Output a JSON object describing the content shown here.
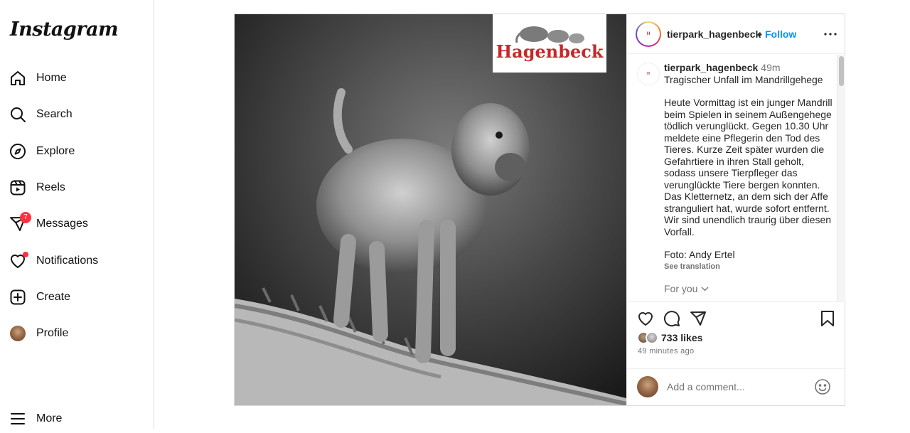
{
  "app": {
    "logo": "Instagram"
  },
  "sidebar": {
    "items": [
      {
        "label": "Home",
        "icon": "home-icon"
      },
      {
        "label": "Search",
        "icon": "search-icon"
      },
      {
        "label": "Explore",
        "icon": "compass-icon"
      },
      {
        "label": "Reels",
        "icon": "reels-icon"
      },
      {
        "label": "Messages",
        "icon": "messenger-icon",
        "badge": "7"
      },
      {
        "label": "Notifications",
        "icon": "heart-icon",
        "has_dot": true
      },
      {
        "label": "Create",
        "icon": "plus-square-icon"
      },
      {
        "label": "Profile",
        "icon": "avatar"
      },
      {
        "label": "More",
        "icon": "menu-icon"
      }
    ]
  },
  "post": {
    "image_logo_text": "Hagenbeck",
    "header": {
      "username": "tierpark_hagenbeck",
      "separator": "•",
      "follow_label": "Follow"
    },
    "caption": {
      "username": "tierpark_hagenbeck",
      "time": "49m",
      "title": "Tragischer Unfall im Mandrillgehege",
      "body": "Heute Vormittag ist ein junger Mandrill beim Spielen in seinem Außengehege tödlich verunglückt. Gegen 10.30 Uhr meldete eine Pflegerin den Tod des Tieres. Kurze Zeit später wurden die Gefahrtiere in ihren Stall geholt, sodass unsere Tierpfleger das verunglückte Tiere bergen konnten. Das Kletternetz, an dem sich der Affe stranguliert hat, wurde sofort entfernt. Wir sind unendlich traurig über diesen Vorfall.",
      "photo_credit": "Foto: Andy Ertel",
      "see_translation": "See translation",
      "for_you": "For you"
    },
    "likes": "733 likes",
    "posted_ago": "49 minutes ago",
    "comment": {
      "placeholder": "Add a comment..."
    }
  },
  "colors": {
    "accent": "#0095f6",
    "badge": "#ff3040",
    "border": "#dbdbdb",
    "brand_red": "#c62828"
  }
}
